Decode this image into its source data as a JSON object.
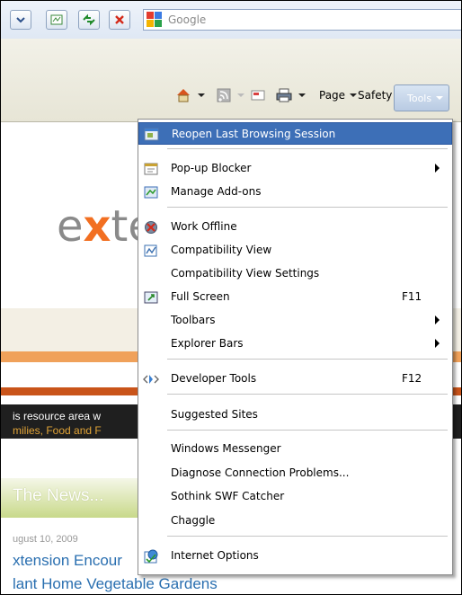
{
  "search": {
    "placeholder": "Google"
  },
  "command_bar": {
    "page_label": "Page",
    "safety_label": "Safety",
    "tools_label": "Tools"
  },
  "page": {
    "logo_text_1": "e",
    "logo_text_2": "x",
    "logo_text_3": "te",
    "intro_line_1": "is resource area w",
    "intro_line_2": "milies, Food and F",
    "news_heading": "The News...",
    "date": "ugust 10, 2009",
    "link_1": "xtension Encour",
    "link_2": "lant Home Vegetable Gardens"
  },
  "menu": {
    "items": [
      {
        "label": "Reopen Last Browsing Session",
        "icon": "reopen-session-icon"
      },
      {
        "label": "Pop-up Blocker",
        "icon": "popup-blocker-icon",
        "submenu": true
      },
      {
        "label": "Manage Add-ons",
        "icon": "addons-icon"
      },
      {
        "label": "Work Offline",
        "icon": "work-offline-icon"
      },
      {
        "label": "Compatibility View",
        "icon": "compatibility-view-icon"
      },
      {
        "label": "Compatibility View Settings"
      },
      {
        "label": "Full Screen",
        "icon": "full-screen-icon",
        "shortcut": "F11"
      },
      {
        "label": "Toolbars",
        "submenu": true
      },
      {
        "label": "Explorer Bars",
        "submenu": true
      },
      {
        "label": "Developer Tools",
        "icon": "developer-tools-icon",
        "shortcut": "F12"
      },
      {
        "label": "Suggested Sites"
      },
      {
        "label": "Windows Messenger"
      },
      {
        "label": "Diagnose Connection Problems..."
      },
      {
        "label": "Sothink SWF Catcher"
      },
      {
        "label": "Chaggle"
      },
      {
        "label": "Internet Options",
        "icon": "internet-options-icon"
      }
    ]
  },
  "colors": {
    "highlight": "#3d6fb7",
    "accent_orange": "#f26f21",
    "link_blue": "#2a6fb0"
  }
}
